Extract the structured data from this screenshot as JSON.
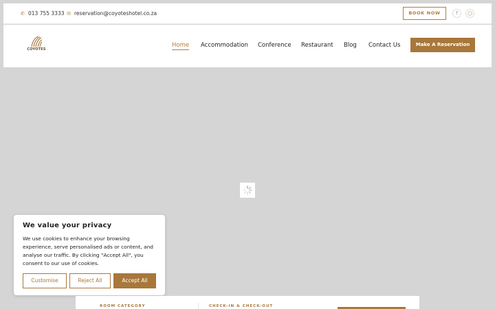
{
  "topbar": {
    "phone": "013 755 3333",
    "email": "reservation@coyoteshotel.co.za",
    "book_now": "BOOK NOW",
    "social": [
      "facebook-icon",
      "instagram-icon"
    ]
  },
  "brand": {
    "logo_text": "COYOTES"
  },
  "nav": {
    "items": [
      {
        "label": "Home",
        "active": true
      },
      {
        "label": "Accommodation"
      },
      {
        "label": "Conference"
      },
      {
        "label": "Restaurant"
      },
      {
        "label": "Blog"
      },
      {
        "label": "Contact Us"
      }
    ],
    "cta": "Make A Reservation"
  },
  "cookie": {
    "title": "We value your privacy",
    "text": "We use cookies to enhance your browsing experience, serve personalised ads or content, and analyse our traffic. By clicking \"Accept All\", you consent to our use of cookies.",
    "customise": "Customise",
    "reject": "Reject All",
    "accept": "Accept All"
  },
  "booking": {
    "room_category": "ROOM CATEGORY",
    "check_in_out": "CHECK-IN & CHECK-OUT"
  },
  "colors": {
    "accent": "#a8773a",
    "hero_bg": "#d5d5d5"
  }
}
